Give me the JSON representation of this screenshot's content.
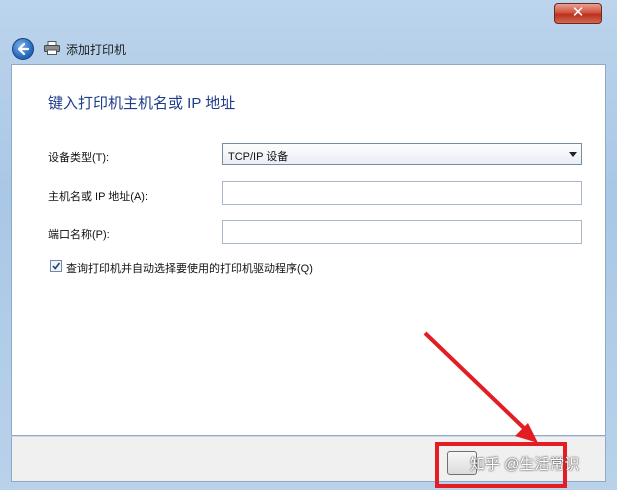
{
  "background_window": {
    "title": ""
  },
  "window": {
    "close_label": "✕",
    "nav_title": "添加打印机"
  },
  "page": {
    "heading": "键入打印机主机名或 IP 地址"
  },
  "form": {
    "device_type_label": "设备类型(T):",
    "device_type_value": "TCP/IP 设备",
    "hostname_label": "主机名或 IP 地址(A):",
    "hostname_value": "",
    "port_label": "端口名称(P):",
    "port_value": "",
    "auto_driver_label": "查询打印机并自动选择要使用的打印机驱动程序(Q)",
    "auto_driver_checked": true
  },
  "watermark": "知乎 @生活常识",
  "colors": {
    "accent_heading": "#1f3d8a",
    "annotation_red": "#e21d24"
  }
}
